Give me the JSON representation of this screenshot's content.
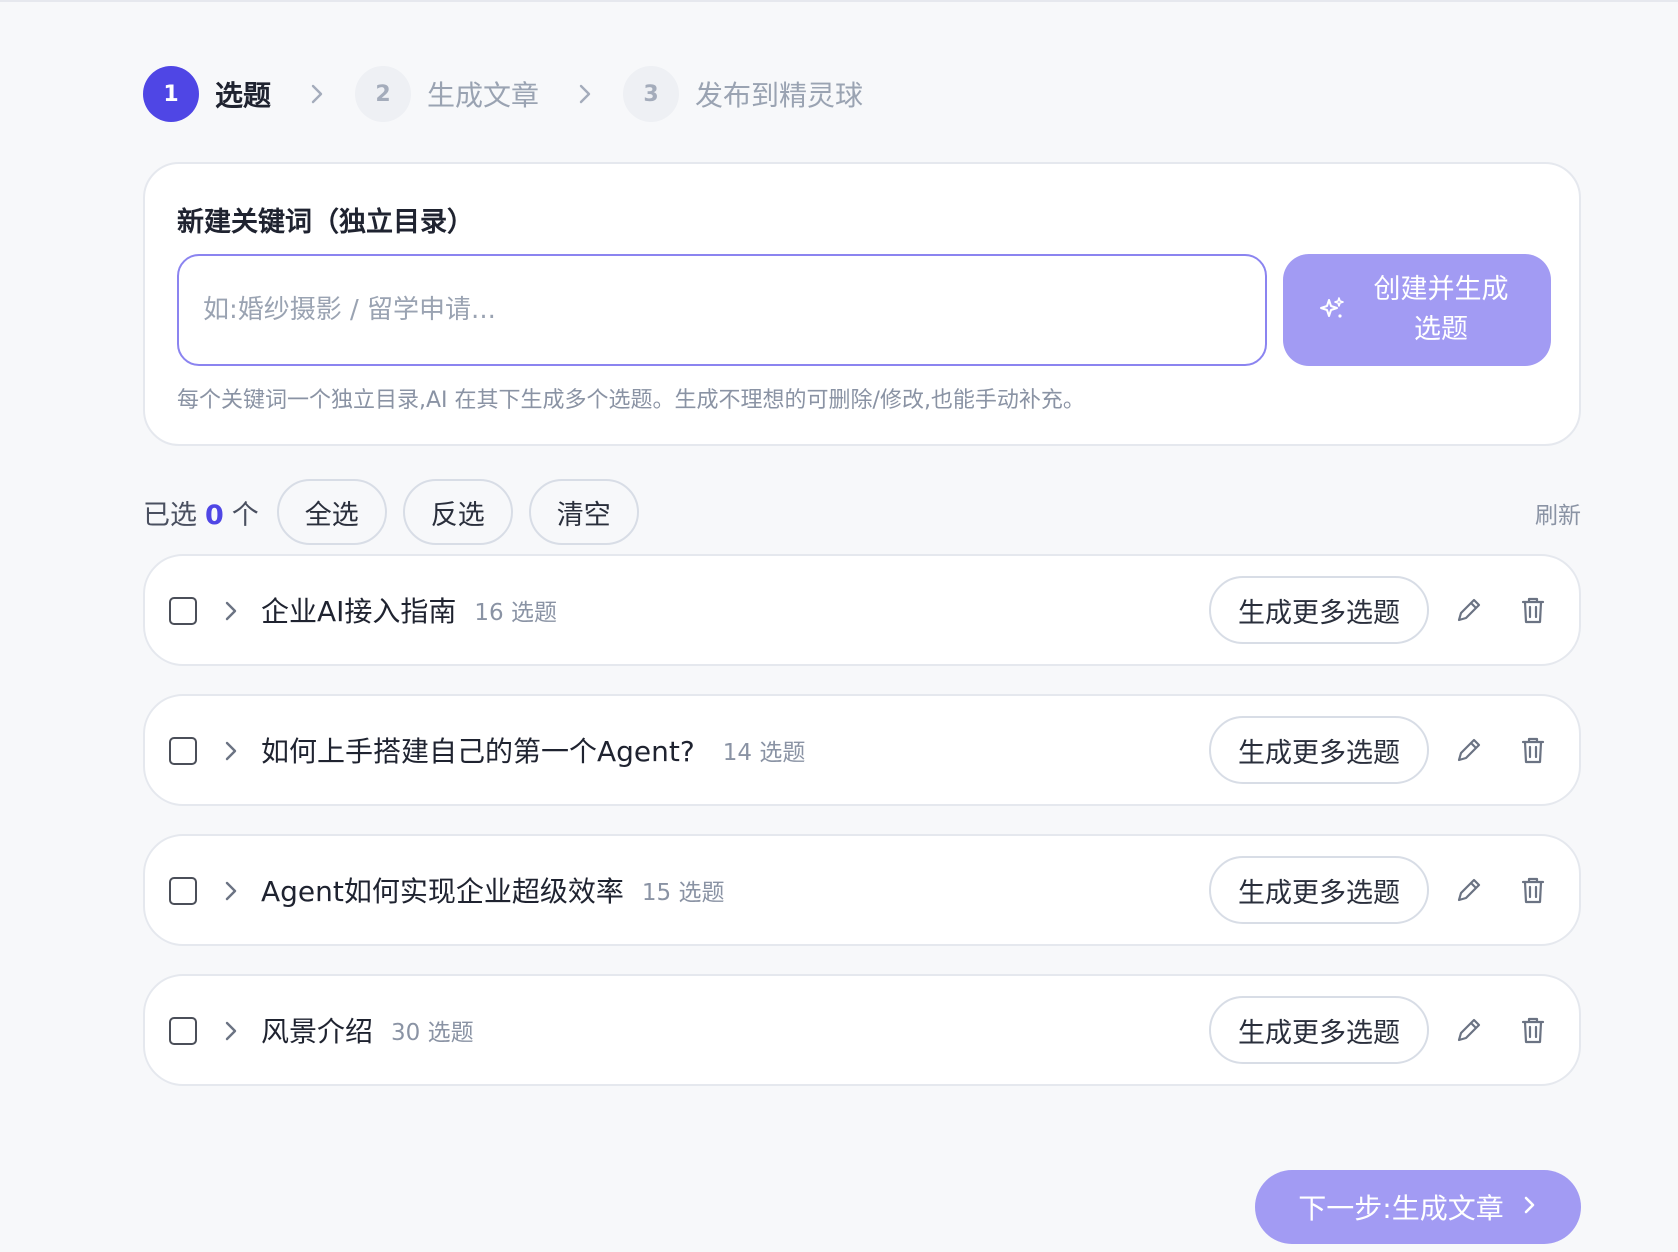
{
  "stepper": {
    "steps": [
      {
        "number": "1",
        "label": "选题",
        "active": true
      },
      {
        "number": "2",
        "label": "生成文章",
        "active": false
      },
      {
        "number": "3",
        "label": "发布到精灵球",
        "active": false
      }
    ]
  },
  "keyword_card": {
    "title": "新建关键词（独立目录）",
    "input_value": "",
    "input_placeholder": "如:婚纱摄影 / 留学申请...",
    "create_button_label": "创建并生成选题",
    "help_text": "每个关键词一个独立目录,AI 在其下生成多个选题。生成不理想的可删除/修改,也能手动补充。"
  },
  "selection": {
    "prefix": "已选",
    "count": "0",
    "suffix": "个",
    "select_all_label": "全选",
    "invert_label": "反选",
    "clear_label": "清空",
    "refresh_label": "刷新"
  },
  "keywords": [
    {
      "title": "企业AI接入指南",
      "count_label": "16 选题",
      "more_label": "生成更多选题"
    },
    {
      "title": "如何上手搭建自己的第一个Agent?",
      "count_label": "14 选题",
      "more_label": "生成更多选题"
    },
    {
      "title": "Agent如何实现企业超级效率",
      "count_label": "15 选题",
      "more_label": "生成更多选题"
    },
    {
      "title": "风景介绍",
      "count_label": "30 选题",
      "more_label": "生成更多选题"
    }
  ],
  "footer": {
    "next_label": "下一步:生成文章"
  },
  "colors": {
    "accent": "#4f46e5",
    "accent_light": "#a29bf3",
    "background": "#f7f8fa"
  },
  "icons": {
    "step_separator": "chevron-right-icon",
    "create": "sparkles-icon",
    "row_expand": "chevron-right-icon",
    "row_edit": "pencil-icon",
    "row_delete": "trash-icon",
    "next": "chevron-right-icon"
  }
}
